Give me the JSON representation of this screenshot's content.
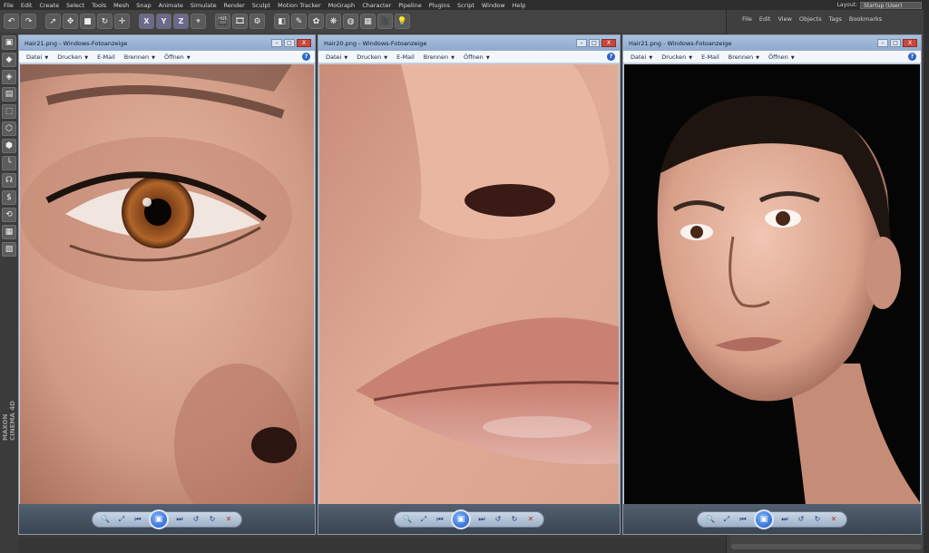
{
  "menubar": {
    "items": [
      "File",
      "Edit",
      "Create",
      "Select",
      "Tools",
      "Mesh",
      "Snap",
      "Animate",
      "Simulate",
      "Render",
      "Sculpt",
      "Motion Tracker",
      "MoGraph",
      "Character",
      "Pipeline",
      "Plugins",
      "Script",
      "Window",
      "Help"
    ],
    "layout_label": "Layout:",
    "layout_value": "Startup (User)"
  },
  "toolbar": {
    "axis_x": "X",
    "axis_y": "Y",
    "axis_z": "Z"
  },
  "object_manager": {
    "menu": [
      "File",
      "Edit",
      "View",
      "Objects",
      "Tags",
      "Bookmarks"
    ]
  },
  "palette": {
    "brand": "MAXON CINEMA 4D"
  },
  "viewer": {
    "commands": [
      {
        "label": "Datei"
      },
      {
        "label": "Drucken"
      },
      {
        "label": "E-Mail"
      },
      {
        "label": "Brennen"
      },
      {
        "label": "Öffnen"
      }
    ],
    "help": "?",
    "min": "–",
    "max": "□",
    "close": "X"
  },
  "windows": [
    {
      "title": "Hair21.png - Windows-Fotoanzeige",
      "subject": "eye"
    },
    {
      "title": "Hair20.png - Windows-Fotoanzeige",
      "subject": "mouth"
    },
    {
      "title": "Hair21.png - Windows-Fotoanzeige",
      "subject": "portrait"
    }
  ],
  "colors": {
    "app_bg": "#3d3d3d",
    "viewer_title": "#a9c1de",
    "viewer_nav": "#3a4552",
    "skin": "#d9a08a",
    "portrait_bg": "#050505"
  }
}
